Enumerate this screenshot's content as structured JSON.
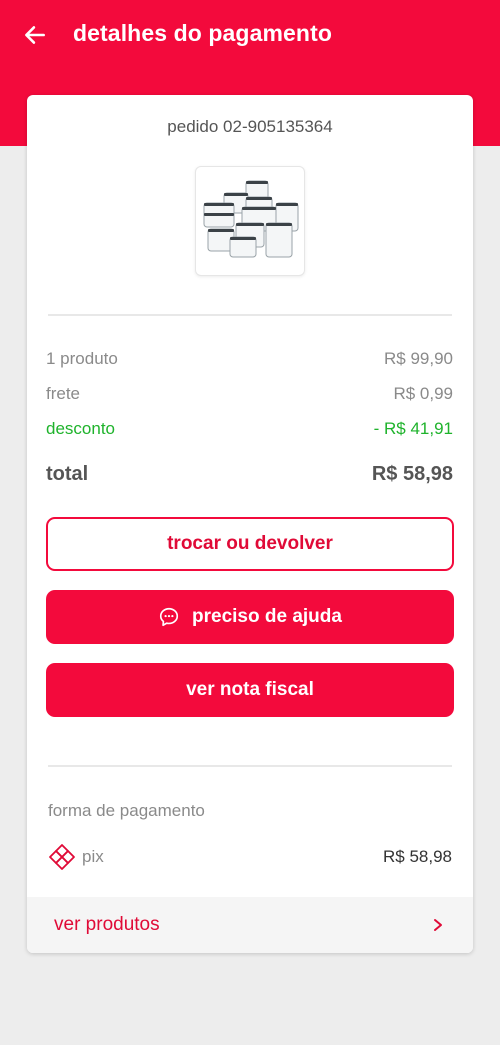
{
  "header": {
    "title": "detalhes do pagamento",
    "back_icon": "arrow-left-icon",
    "color": "#f30a3c"
  },
  "order": {
    "id_label": "pedido 02-905135364",
    "product_image": "food-storage-containers-set"
  },
  "summary": {
    "products_label": "1 produto",
    "products_value": "R$ 99,90",
    "shipping_label": "frete",
    "shipping_value": "R$ 0,99",
    "discount_label": "desconto",
    "discount_value": "- R$ 41,91",
    "discount_color": "#1fb32c",
    "total_label": "total",
    "total_value": "R$ 58,98"
  },
  "actions": {
    "exchange_label": "trocar ou devolver",
    "help_label": "preciso de ajuda",
    "help_icon": "chat-bubble-icon",
    "invoice_label": "ver nota fiscal"
  },
  "payment": {
    "section_label": "forma de pagamento",
    "method_icon": "pix-icon",
    "method_label": "pix",
    "amount": "R$ 58,98"
  },
  "footer": {
    "link_label": "ver produtos",
    "chevron_icon": "chevron-right-icon"
  }
}
